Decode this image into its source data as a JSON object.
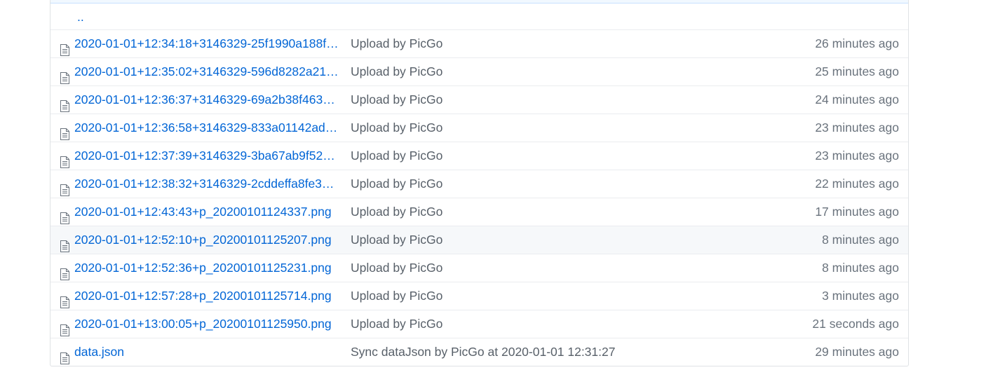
{
  "table": {
    "up_label": "..",
    "rows": [
      {
        "icon": "file-icon",
        "name": "2020-01-01+12:34:18+3146329-25f1990a188f…",
        "message": "Upload by PicGo",
        "age": "26 minutes ago"
      },
      {
        "icon": "file-icon",
        "name": "2020-01-01+12:35:02+3146329-596d8282a217…",
        "message": "Upload by PicGo",
        "age": "25 minutes ago"
      },
      {
        "icon": "file-icon",
        "name": "2020-01-01+12:36:37+3146329-69a2b38f4634…",
        "message": "Upload by PicGo",
        "age": "24 minutes ago"
      },
      {
        "icon": "file-icon",
        "name": "2020-01-01+12:36:58+3146329-833a01142ad9…",
        "message": "Upload by PicGo",
        "age": "23 minutes ago"
      },
      {
        "icon": "file-icon",
        "name": "2020-01-01+12:37:39+3146329-3ba67ab9f522…",
        "message": "Upload by PicGo",
        "age": "23 minutes ago"
      },
      {
        "icon": "file-icon",
        "name": "2020-01-01+12:38:32+3146329-2cddeffa8fe35…",
        "message": "Upload by PicGo",
        "age": "22 minutes ago"
      },
      {
        "icon": "file-icon",
        "name": "2020-01-01+12:43:43+p_20200101124337.png",
        "message": "Upload by PicGo",
        "age": "17 minutes ago"
      },
      {
        "icon": "file-icon",
        "name": "2020-01-01+12:52:10+p_20200101125207.png",
        "message": "Upload by PicGo",
        "age": "8 minutes ago"
      },
      {
        "icon": "file-icon",
        "name": "2020-01-01+12:52:36+p_20200101125231.png",
        "message": "Upload by PicGo",
        "age": "8 minutes ago"
      },
      {
        "icon": "file-icon",
        "name": "2020-01-01+12:57:28+p_20200101125714.png",
        "message": "Upload by PicGo",
        "age": "3 minutes ago"
      },
      {
        "icon": "file-icon",
        "name": "2020-01-01+13:00:05+p_20200101125950.png",
        "message": "Upload by PicGo",
        "age": "21 seconds ago"
      },
      {
        "icon": "file-icon",
        "name": "data.json",
        "message": "Sync dataJson by PicGo at 2020-01-01 12:31:27",
        "age": "29 minutes ago"
      }
    ]
  },
  "colors": {
    "link": "#0366d6",
    "text_muted": "#586069",
    "border": "#eaecef",
    "hover_row": "#f6f8fa"
  }
}
